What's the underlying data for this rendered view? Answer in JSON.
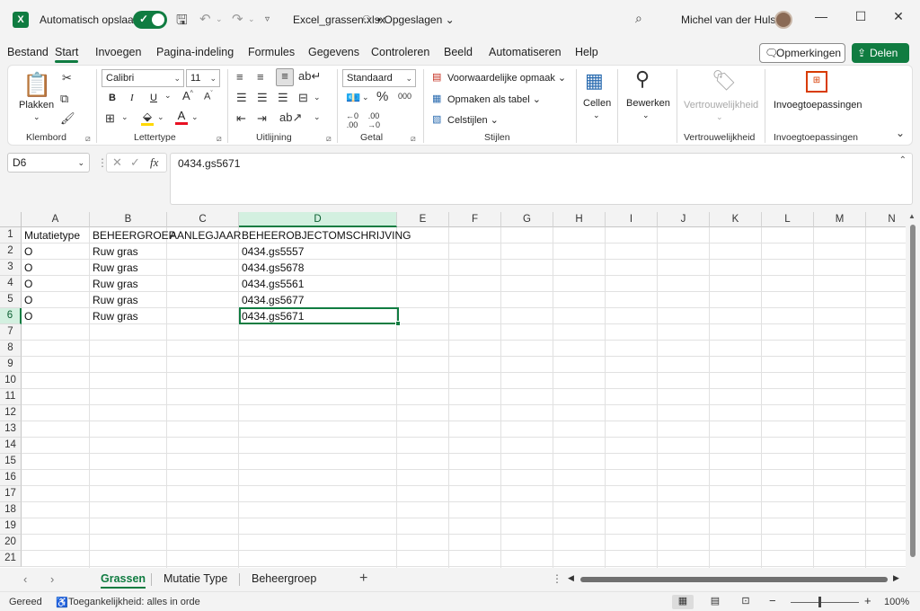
{
  "titlebar": {
    "logo": "X",
    "autosave_label": "Automatisch opslaan",
    "filename": "Excel_grassen.xlsx",
    "saved_state": "• Opgeslagen ⌄",
    "username": "Michel van der Hulst"
  },
  "menu": {
    "tabs": [
      "Bestand",
      "Start",
      "Invoegen",
      "Pagina-indeling",
      "Formules",
      "Gegevens",
      "Controleren",
      "Beeld",
      "Automatiseren",
      "Help"
    ],
    "active": "Start",
    "comments_label": "Opmerkingen",
    "share_label": "Delen ⌄"
  },
  "ribbon": {
    "clipboard": {
      "group": "Klembord",
      "paste": "Plakken"
    },
    "font": {
      "group": "Lettertype",
      "name": "Calibri",
      "size": "11",
      "bold": "B",
      "italic": "I",
      "underline": "U"
    },
    "alignment": {
      "group": "Uitlijning"
    },
    "number": {
      "group": "Getal",
      "format": "Standaard"
    },
    "styles": {
      "group": "Stijlen",
      "conditional": "Voorwaardelijke opmaak ⌄",
      "as_table": "Opmaken als tabel ⌄",
      "cell_styles": "Celstijlen ⌄"
    },
    "cells": {
      "label": "Cellen"
    },
    "editing": {
      "label": "Bewerken"
    },
    "sensitivity": {
      "group": "Vertrouwelijkheid",
      "label": "Vertrouwelijkheid"
    },
    "addins": {
      "group": "Invoegtoepassingen",
      "label": "Invoegtoepassingen"
    }
  },
  "formula_bar": {
    "name_box": "D6",
    "fx": "fx",
    "content": "0434.gs5671"
  },
  "sheet": {
    "columns": [
      "A",
      "B",
      "C",
      "D",
      "E",
      "F",
      "G",
      "H",
      "I",
      "J",
      "K",
      "L",
      "M",
      "N"
    ],
    "selected_column": "D",
    "row_numbers": [
      "1",
      "2",
      "3",
      "4",
      "5",
      "6",
      "7",
      "8",
      "9",
      "10",
      "11",
      "12",
      "13",
      "14",
      "15",
      "16",
      "17",
      "18",
      "19",
      "20",
      "21"
    ],
    "selected_row": "6",
    "active_cell": "D6",
    "rows": [
      [
        "Mutatietype",
        "BEHEERGROEP",
        "AANLEGJAAR",
        "BEHEEROBJECTOMSCHRIJVING"
      ],
      [
        "O",
        "Ruw gras",
        "",
        "0434.gs5557"
      ],
      [
        "O",
        "Ruw gras",
        "",
        "0434.gs5678"
      ],
      [
        "O",
        "Ruw gras",
        "",
        "0434.gs5561"
      ],
      [
        "O",
        "Ruw gras",
        "",
        "0434.gs5677"
      ],
      [
        "O",
        "Ruw gras",
        "",
        "0434.gs5671"
      ]
    ]
  },
  "sheet_tabs": {
    "tabs": [
      "Grassen",
      "Mutatie Type",
      "Beheergroep"
    ],
    "active": "Grassen"
  },
  "statusbar": {
    "ready": "Gereed",
    "accessibility": "Toegankelijkheid: alles in orde",
    "zoom": "100%",
    "zoom_minus": "−",
    "zoom_plus": "+"
  }
}
